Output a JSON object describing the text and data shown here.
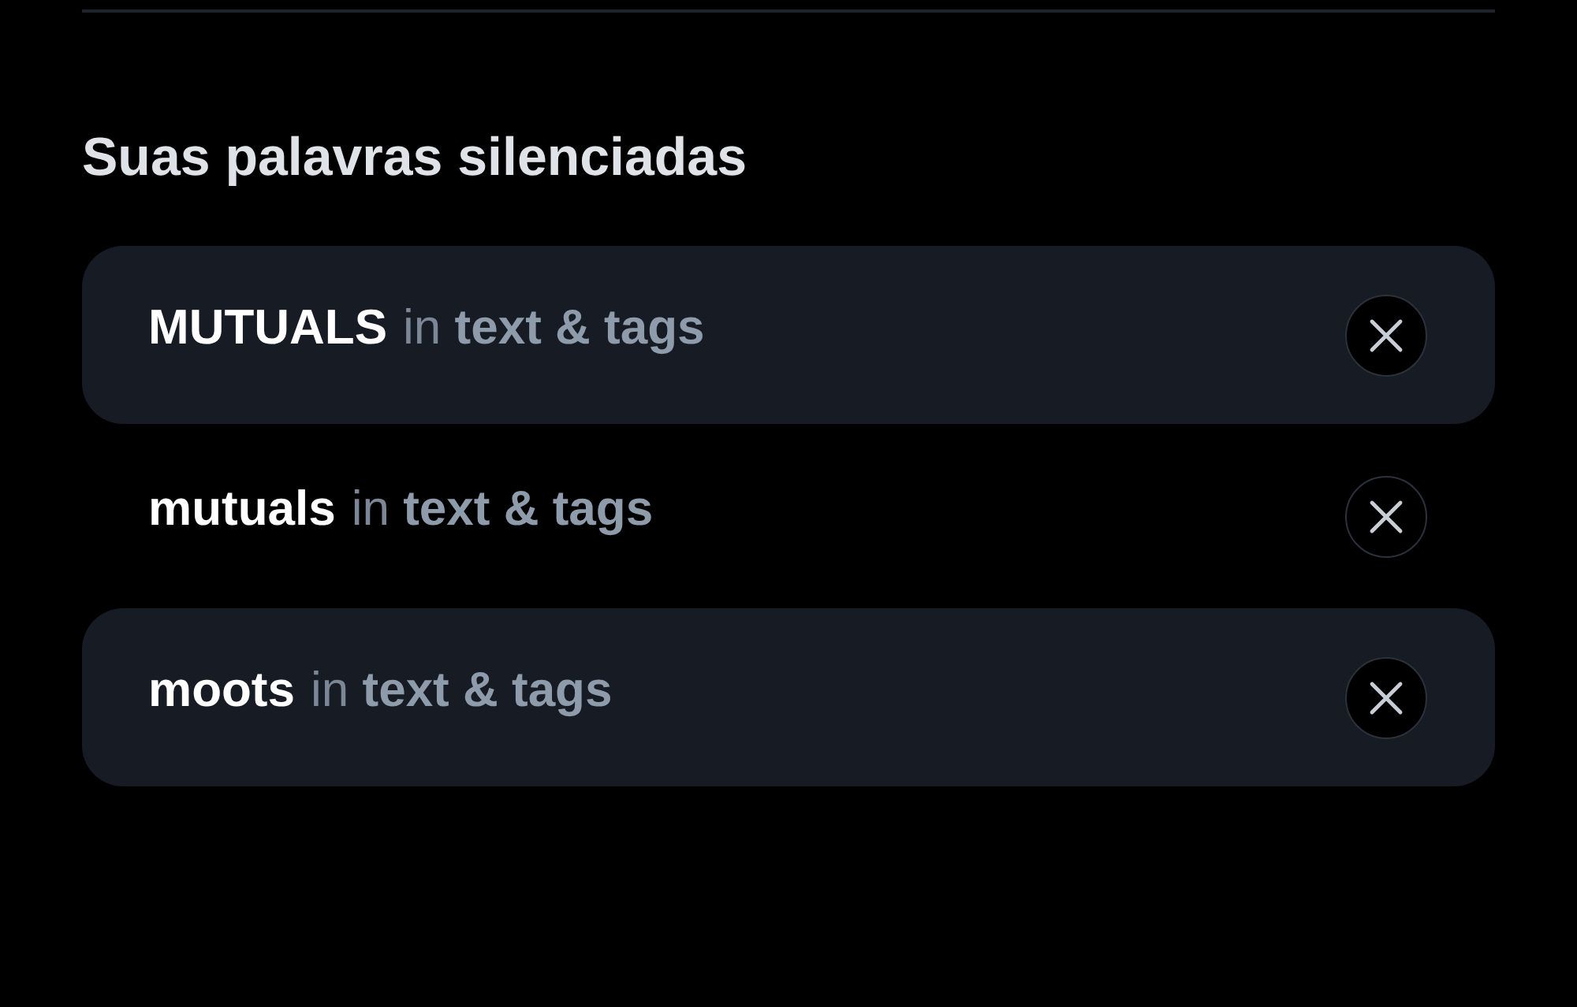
{
  "heading": "Suas palavras silenciadas",
  "muted_words": [
    {
      "word": "MUTUALS",
      "scope": "in **text & tags**"
    },
    {
      "word": "mutuals",
      "scope": "in **text & tags**"
    },
    {
      "word": "moots",
      "scope": "in **text & tags**"
    }
  ]
}
